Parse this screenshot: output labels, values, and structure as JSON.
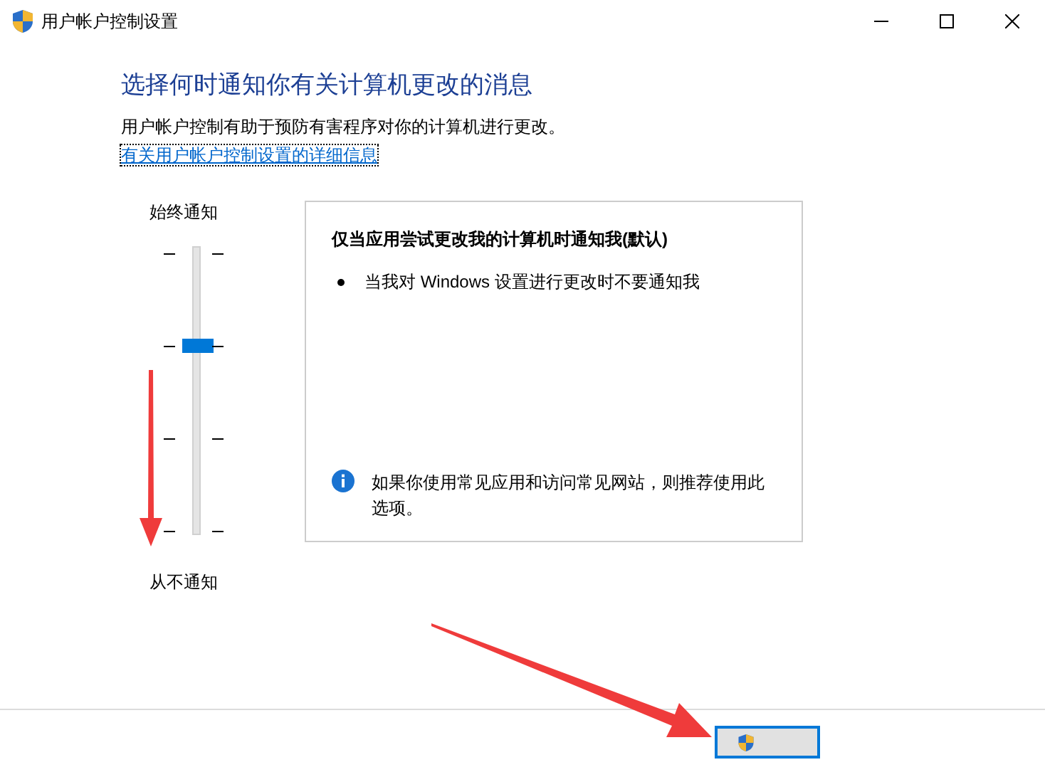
{
  "window": {
    "title": "用户帐户控制设置"
  },
  "heading": "选择何时通知你有关计算机更改的消息",
  "description": "用户帐户控制有助于预防有害程序对你的计算机进行更改。",
  "link": "有关用户帐户控制设置的详细信息",
  "slider": {
    "top_label": "始终通知",
    "bottom_label": "从不通知",
    "level": 0.667
  },
  "panel": {
    "title": "仅当应用尝试更改我的计算机时通知我(默认)",
    "bullets": [
      "当我对 Windows 设置进行更改时不要通知我"
    ],
    "info": "如果你使用常见应用和访问常见网站，则推荐使用此选项。"
  },
  "footer": {
    "buttons": [
      {
        "kind": "shield",
        "focused": true
      }
    ]
  }
}
